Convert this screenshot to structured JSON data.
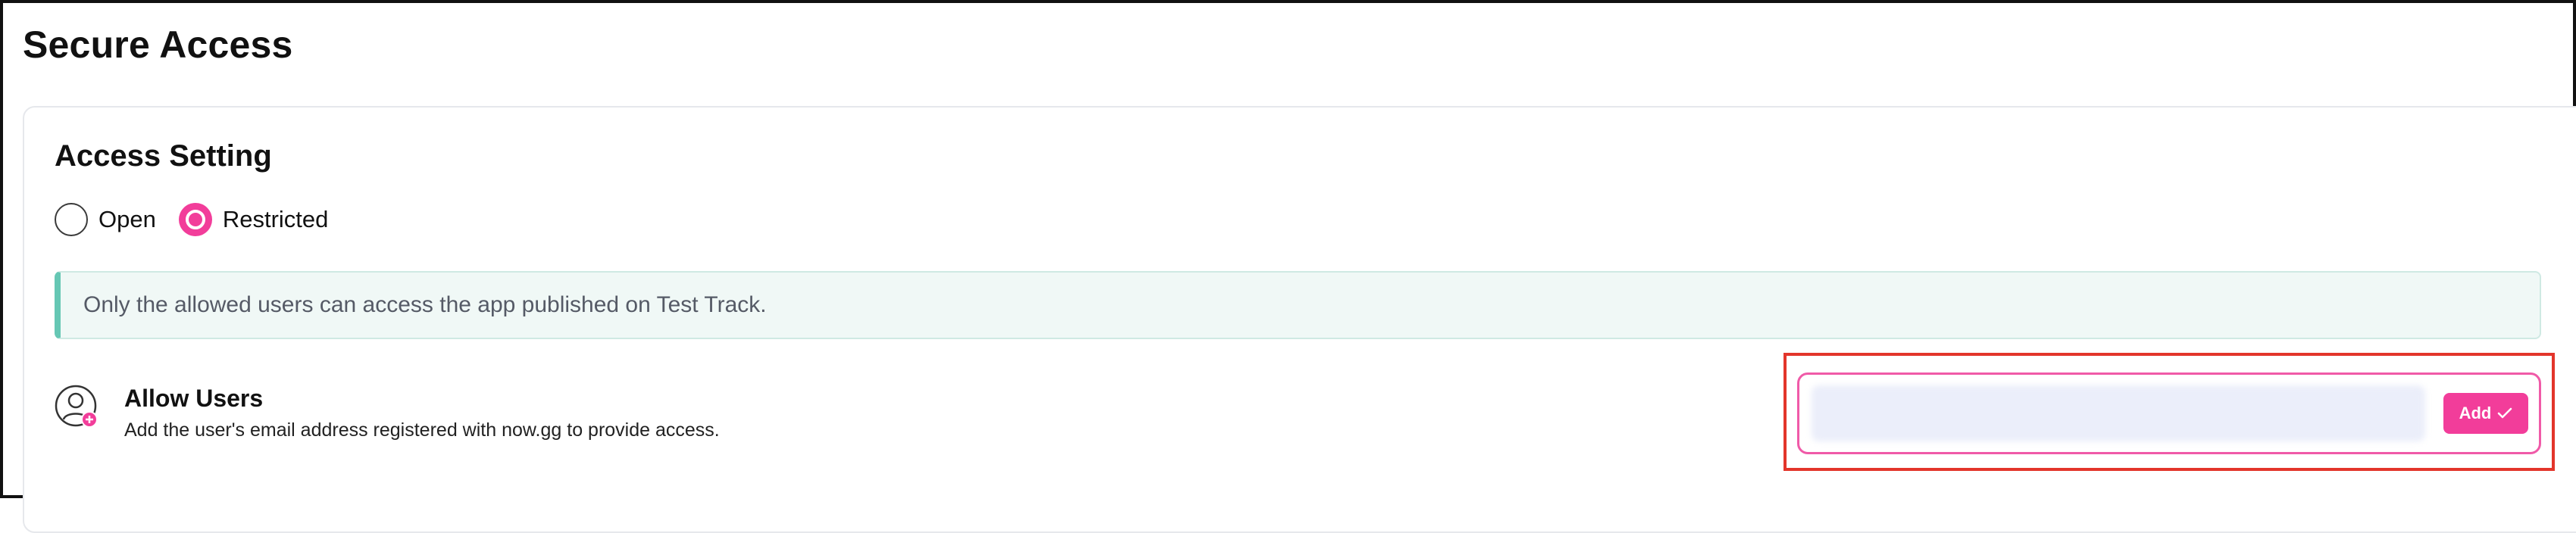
{
  "page": {
    "title": "Secure Access"
  },
  "access_setting": {
    "title": "Access Setting",
    "options": [
      {
        "label": "Open",
        "selected": false
      },
      {
        "label": "Restricted",
        "selected": true
      }
    ],
    "info_text": "Only the allowed users can access the app published on Test Track."
  },
  "allow_users": {
    "title": "Allow Users",
    "description": "Add the user's email address registered with now.gg to provide access.",
    "input_value": "",
    "add_label": "Add"
  },
  "colors": {
    "accent": "#f23d9a",
    "info_bg": "#f0f8f6",
    "info_border": "#66c7b4",
    "highlight": "#e3352b"
  },
  "icons": {
    "user": "user-add-icon",
    "check": "check-icon"
  }
}
